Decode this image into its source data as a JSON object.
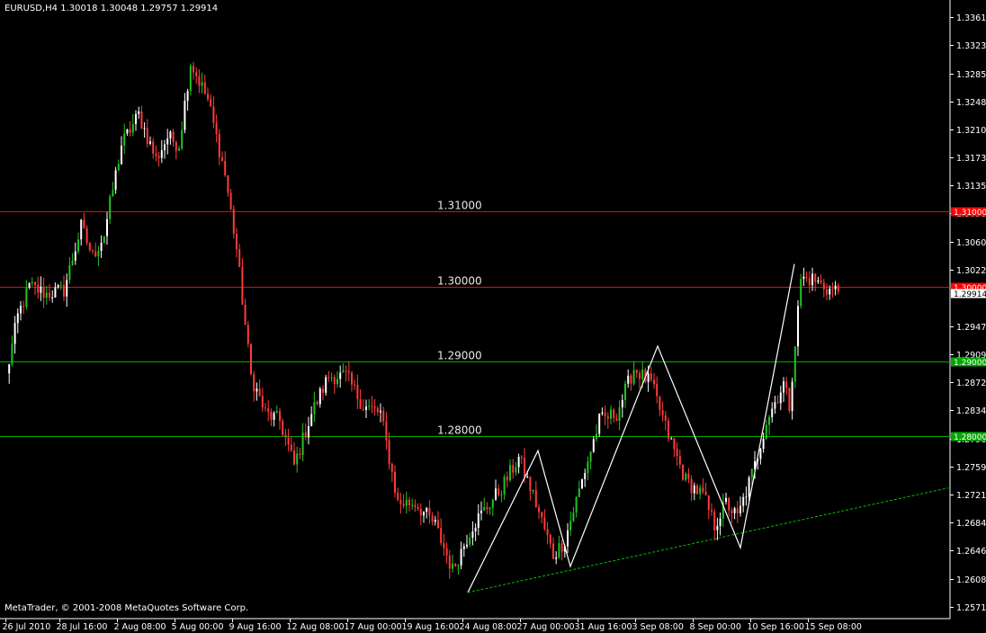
{
  "window": {
    "symbol_info": "EURUSD,H4  1.30018 1.30048 1.29757 1.29914",
    "copyright": "MetaTrader, © 2001-2008 MetaQuotes Software Corp."
  },
  "colors": {
    "background": "#000000",
    "axis": "#ffffff",
    "bull_candle": "#ffffff",
    "bear_candle": "#ff3b3b",
    "green_candle": "#22c322",
    "red_line": "#ff0000",
    "green_line": "#00a800",
    "trendline": "#00c000",
    "zigzag": "#ffffff"
  },
  "chart_data": {
    "type": "candlestick",
    "symbol": "EURUSD",
    "timeframe": "H4",
    "ylim": [
      1.2555,
      1.338
    ],
    "y_ticks": [
      1.3361,
      1.3323,
      1.3285,
      1.3248,
      1.321,
      1.3173,
      1.3135,
      1.3098,
      1.306,
      1.3022,
      1.2947,
      1.2909,
      1.2872,
      1.2834,
      1.2796,
      1.2759,
      1.2721,
      1.2684,
      1.2646,
      1.2608,
      1.2571
    ],
    "x_ticks": [
      "26 Jul 2010",
      "28 Jul 16:00",
      "2 Aug 08:00",
      "5 Aug 00:00",
      "9 Aug 16:00",
      "12 Aug 08:00",
      "17 Aug 00:00",
      "19 Aug 16:00",
      "24 Aug 08:00",
      "27 Aug 00:00",
      "31 Aug 16:00",
      "3 Sep 08:00",
      "8 Sep 00:00",
      "10 Sep 16:00",
      "15 Sep 08:00"
    ],
    "horizontal_lines": [
      {
        "price": 1.31,
        "label": "1.31000",
        "tag": "1.31000",
        "color": "red"
      },
      {
        "price": 1.3,
        "label": "1.30000",
        "tag": "1.30000",
        "color": "red"
      },
      {
        "price": 1.29,
        "label": "1.29000",
        "tag": "1.29000",
        "color": "green"
      },
      {
        "price": 1.28,
        "label": "1.28000",
        "tag": "1.28000",
        "color": "green"
      }
    ],
    "current_price": {
      "value": 1.29914,
      "label": "1.29914"
    },
    "anchors": [
      [
        0,
        1.288
      ],
      [
        4,
        1.296
      ],
      [
        8,
        1.3
      ],
      [
        14,
        1.299
      ],
      [
        20,
        1.2995
      ],
      [
        26,
        1.308
      ],
      [
        30,
        1.304
      ],
      [
        34,
        1.307
      ],
      [
        40,
        1.319
      ],
      [
        46,
        1.323
      ],
      [
        52,
        1.317
      ],
      [
        56,
        1.32
      ],
      [
        60,
        1.319
      ],
      [
        64,
        1.33
      ],
      [
        70,
        1.325
      ],
      [
        76,
        1.315
      ],
      [
        80,
        1.305
      ],
      [
        85,
        1.288
      ],
      [
        90,
        1.283
      ],
      [
        95,
        1.282
      ],
      [
        100,
        1.276
      ],
      [
        106,
        1.283
      ],
      [
        112,
        1.288
      ],
      [
        118,
        1.288
      ],
      [
        124,
        1.284
      ],
      [
        130,
        1.283
      ],
      [
        136,
        1.271
      ],
      [
        142,
        1.271
      ],
      [
        149,
        1.268
      ],
      [
        155,
        1.262
      ],
      [
        162,
        1.268
      ],
      [
        172,
        1.273
      ],
      [
        178,
        1.277
      ],
      [
        183,
        1.272
      ],
      [
        190,
        1.264
      ],
      [
        194,
        1.266
      ],
      [
        200,
        1.274
      ],
      [
        206,
        1.282
      ],
      [
        212,
        1.283
      ],
      [
        218,
        1.289
      ],
      [
        224,
        1.287
      ],
      [
        230,
        1.28
      ],
      [
        236,
        1.274
      ],
      [
        242,
        1.272
      ],
      [
        246,
        1.268
      ],
      [
        250,
        1.271
      ],
      [
        254,
        1.269
      ],
      [
        260,
        1.276
      ],
      [
        264,
        1.282
      ],
      [
        270,
        1.287
      ],
      [
        272,
        1.284
      ],
      [
        276,
        1.301
      ],
      [
        280,
        1.301
      ],
      [
        286,
        1.2995
      ]
    ],
    "zigzag": [
      [
        "24 Aug 08:00",
        1.259
      ],
      [
        "27 Aug 00:00",
        1.278
      ],
      [
        "30 Aug 08:00",
        1.2625
      ],
      [
        "3 Sep 08:00",
        1.292
      ],
      [
        "9 Sep 16:00",
        1.265
      ],
      [
        "13 Sep 08:00",
        1.303
      ]
    ],
    "trendline": [
      [
        "24 Aug 08:00",
        1.259
      ],
      [
        "17 Sep 16:00",
        1.273
      ]
    ]
  }
}
